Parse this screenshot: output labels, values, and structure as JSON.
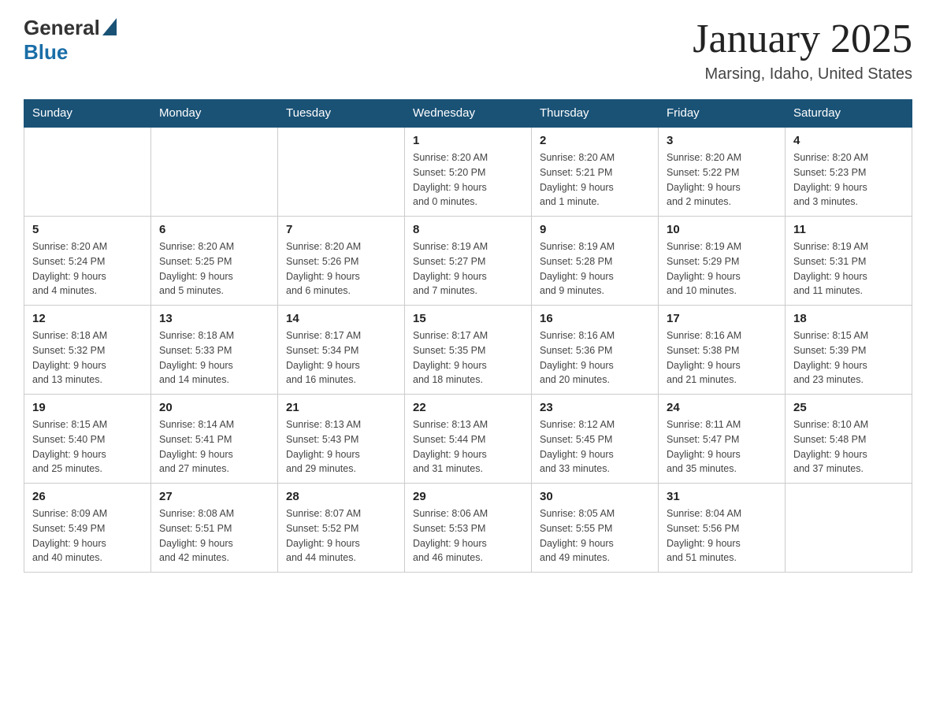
{
  "logo": {
    "general": "General",
    "blue": "Blue"
  },
  "title": "January 2025",
  "subtitle": "Marsing, Idaho, United States",
  "days_of_week": [
    "Sunday",
    "Monday",
    "Tuesday",
    "Wednesday",
    "Thursday",
    "Friday",
    "Saturday"
  ],
  "weeks": [
    [
      {
        "day": "",
        "info": ""
      },
      {
        "day": "",
        "info": ""
      },
      {
        "day": "",
        "info": ""
      },
      {
        "day": "1",
        "info": "Sunrise: 8:20 AM\nSunset: 5:20 PM\nDaylight: 9 hours\nand 0 minutes."
      },
      {
        "day": "2",
        "info": "Sunrise: 8:20 AM\nSunset: 5:21 PM\nDaylight: 9 hours\nand 1 minute."
      },
      {
        "day": "3",
        "info": "Sunrise: 8:20 AM\nSunset: 5:22 PM\nDaylight: 9 hours\nand 2 minutes."
      },
      {
        "day": "4",
        "info": "Sunrise: 8:20 AM\nSunset: 5:23 PM\nDaylight: 9 hours\nand 3 minutes."
      }
    ],
    [
      {
        "day": "5",
        "info": "Sunrise: 8:20 AM\nSunset: 5:24 PM\nDaylight: 9 hours\nand 4 minutes."
      },
      {
        "day": "6",
        "info": "Sunrise: 8:20 AM\nSunset: 5:25 PM\nDaylight: 9 hours\nand 5 minutes."
      },
      {
        "day": "7",
        "info": "Sunrise: 8:20 AM\nSunset: 5:26 PM\nDaylight: 9 hours\nand 6 minutes."
      },
      {
        "day": "8",
        "info": "Sunrise: 8:19 AM\nSunset: 5:27 PM\nDaylight: 9 hours\nand 7 minutes."
      },
      {
        "day": "9",
        "info": "Sunrise: 8:19 AM\nSunset: 5:28 PM\nDaylight: 9 hours\nand 9 minutes."
      },
      {
        "day": "10",
        "info": "Sunrise: 8:19 AM\nSunset: 5:29 PM\nDaylight: 9 hours\nand 10 minutes."
      },
      {
        "day": "11",
        "info": "Sunrise: 8:19 AM\nSunset: 5:31 PM\nDaylight: 9 hours\nand 11 minutes."
      }
    ],
    [
      {
        "day": "12",
        "info": "Sunrise: 8:18 AM\nSunset: 5:32 PM\nDaylight: 9 hours\nand 13 minutes."
      },
      {
        "day": "13",
        "info": "Sunrise: 8:18 AM\nSunset: 5:33 PM\nDaylight: 9 hours\nand 14 minutes."
      },
      {
        "day": "14",
        "info": "Sunrise: 8:17 AM\nSunset: 5:34 PM\nDaylight: 9 hours\nand 16 minutes."
      },
      {
        "day": "15",
        "info": "Sunrise: 8:17 AM\nSunset: 5:35 PM\nDaylight: 9 hours\nand 18 minutes."
      },
      {
        "day": "16",
        "info": "Sunrise: 8:16 AM\nSunset: 5:36 PM\nDaylight: 9 hours\nand 20 minutes."
      },
      {
        "day": "17",
        "info": "Sunrise: 8:16 AM\nSunset: 5:38 PM\nDaylight: 9 hours\nand 21 minutes."
      },
      {
        "day": "18",
        "info": "Sunrise: 8:15 AM\nSunset: 5:39 PM\nDaylight: 9 hours\nand 23 minutes."
      }
    ],
    [
      {
        "day": "19",
        "info": "Sunrise: 8:15 AM\nSunset: 5:40 PM\nDaylight: 9 hours\nand 25 minutes."
      },
      {
        "day": "20",
        "info": "Sunrise: 8:14 AM\nSunset: 5:41 PM\nDaylight: 9 hours\nand 27 minutes."
      },
      {
        "day": "21",
        "info": "Sunrise: 8:13 AM\nSunset: 5:43 PM\nDaylight: 9 hours\nand 29 minutes."
      },
      {
        "day": "22",
        "info": "Sunrise: 8:13 AM\nSunset: 5:44 PM\nDaylight: 9 hours\nand 31 minutes."
      },
      {
        "day": "23",
        "info": "Sunrise: 8:12 AM\nSunset: 5:45 PM\nDaylight: 9 hours\nand 33 minutes."
      },
      {
        "day": "24",
        "info": "Sunrise: 8:11 AM\nSunset: 5:47 PM\nDaylight: 9 hours\nand 35 minutes."
      },
      {
        "day": "25",
        "info": "Sunrise: 8:10 AM\nSunset: 5:48 PM\nDaylight: 9 hours\nand 37 minutes."
      }
    ],
    [
      {
        "day": "26",
        "info": "Sunrise: 8:09 AM\nSunset: 5:49 PM\nDaylight: 9 hours\nand 40 minutes."
      },
      {
        "day": "27",
        "info": "Sunrise: 8:08 AM\nSunset: 5:51 PM\nDaylight: 9 hours\nand 42 minutes."
      },
      {
        "day": "28",
        "info": "Sunrise: 8:07 AM\nSunset: 5:52 PM\nDaylight: 9 hours\nand 44 minutes."
      },
      {
        "day": "29",
        "info": "Sunrise: 8:06 AM\nSunset: 5:53 PM\nDaylight: 9 hours\nand 46 minutes."
      },
      {
        "day": "30",
        "info": "Sunrise: 8:05 AM\nSunset: 5:55 PM\nDaylight: 9 hours\nand 49 minutes."
      },
      {
        "day": "31",
        "info": "Sunrise: 8:04 AM\nSunset: 5:56 PM\nDaylight: 9 hours\nand 51 minutes."
      },
      {
        "day": "",
        "info": ""
      }
    ]
  ]
}
